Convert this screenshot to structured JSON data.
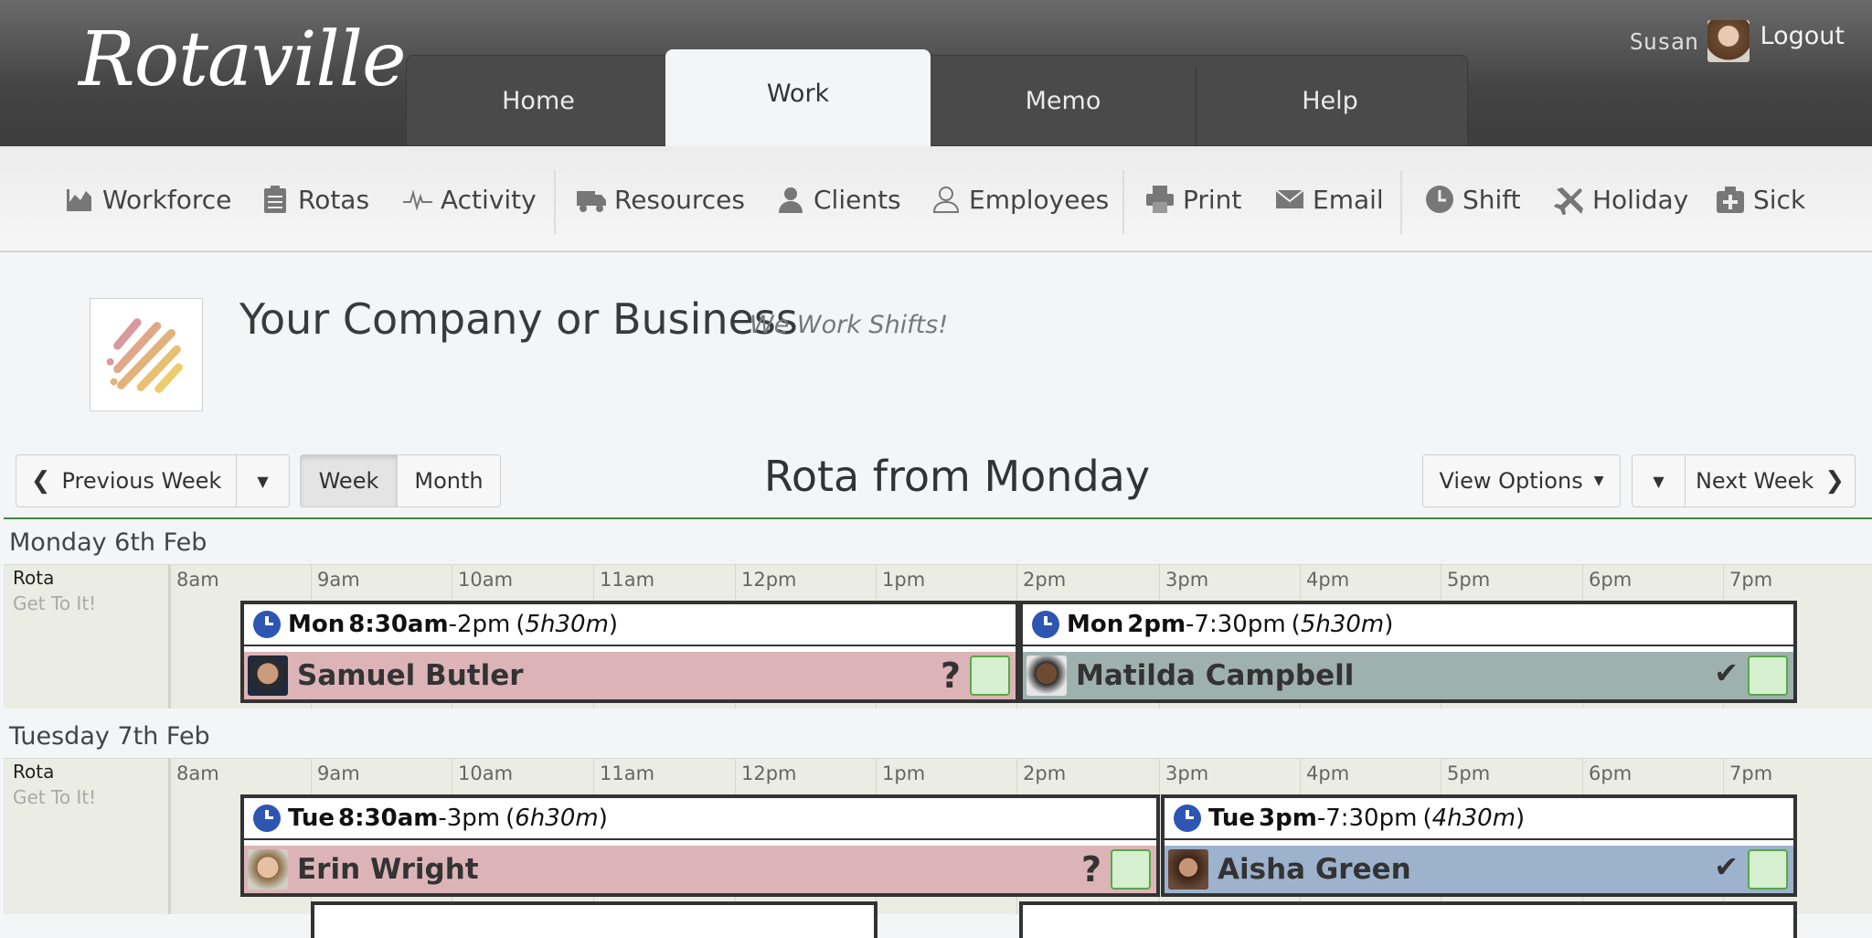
{
  "app": {
    "logo": "Rotaville",
    "user_name": "Susan",
    "logout": "Logout"
  },
  "tabs": [
    {
      "label": "Home",
      "active": false
    },
    {
      "label": "Work",
      "active": true
    },
    {
      "label": "Memo",
      "active": false
    },
    {
      "label": "Help",
      "active": false
    }
  ],
  "toolbar": [
    {
      "label": "Workforce",
      "icon": "chart-icon"
    },
    {
      "label": "Rotas",
      "icon": "clipboard-icon"
    },
    {
      "label": "Activity",
      "icon": "pulse-icon"
    },
    {
      "label": "Resources",
      "icon": "truck-icon"
    },
    {
      "label": "Clients",
      "icon": "client-icon"
    },
    {
      "label": "Employees",
      "icon": "user-icon"
    },
    {
      "label": "Print",
      "icon": "print-icon"
    },
    {
      "label": "Email",
      "icon": "email-icon"
    },
    {
      "label": "Shift",
      "icon": "clock-icon"
    },
    {
      "label": "Holiday",
      "icon": "plane-icon"
    },
    {
      "label": "Sick",
      "icon": "medical-icon"
    }
  ],
  "company": {
    "name": "Your Company or Business",
    "tagline": "We Work Shifts!"
  },
  "controls": {
    "previous_week": "Previous Week",
    "week": "Week",
    "month": "Month",
    "title": "Rota from Monday",
    "view_options": "View Options",
    "next_week": "Next Week"
  },
  "hours": [
    "8am",
    "9am",
    "10am",
    "11am",
    "12pm",
    "1pm",
    "2pm",
    "3pm",
    "4pm",
    "5pm",
    "6pm",
    "7pm"
  ],
  "days": [
    {
      "label": "Monday 6th Feb",
      "rota_label": "Rota",
      "rota_sub": "Get To It!",
      "shifts": [
        {
          "day": "Mon",
          "start": "8:30am",
          "end": "-2pm",
          "duration": "5h30m",
          "employee": "Samuel Butler",
          "status": "?",
          "color": "#dcb4b8"
        },
        {
          "day": "Mon",
          "start": "2pm",
          "end": "-7:30pm",
          "duration": "5h30m",
          "employee": "Matilda Campbell",
          "status": "✔",
          "color": "#9fb1ae"
        }
      ]
    },
    {
      "label": "Tuesday 7th Feb",
      "rota_label": "Rota",
      "rota_sub": "Get To It!",
      "shifts": [
        {
          "day": "Tue",
          "start": "8:30am",
          "end": "-3pm",
          "duration": "6h30m",
          "employee": "Erin Wright",
          "status": "?",
          "color": "#dcb4b8"
        },
        {
          "day": "Tue",
          "start": "3pm",
          "end": "-7:30pm",
          "duration": "4h30m",
          "employee": "Aisha Green",
          "status": "✔",
          "color": "#9db2cc"
        }
      ]
    }
  ]
}
